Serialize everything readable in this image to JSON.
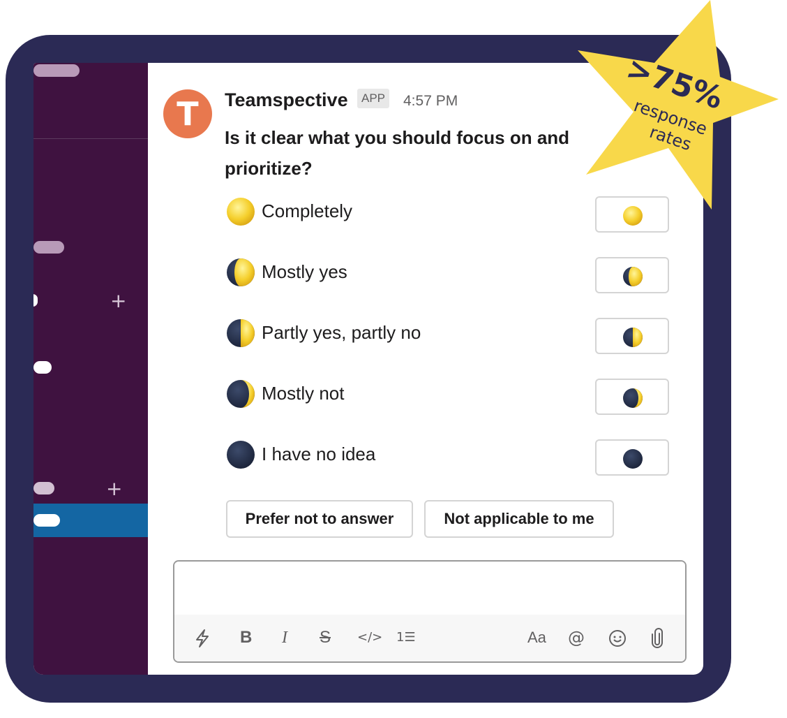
{
  "message": {
    "sender": "Teamspective",
    "avatar_letter": "T",
    "badge": "APP",
    "time": "4:57 PM",
    "question": "Is it clear what you should focus on and prioritize?"
  },
  "options": [
    {
      "label": "Completely",
      "icon": "full-moon-icon"
    },
    {
      "label": "Mostly yes",
      "icon": "waxing-gibbous-moon-icon"
    },
    {
      "label": "Partly yes, partly no",
      "icon": "first-quarter-moon-icon"
    },
    {
      "label": "Mostly not",
      "icon": "waxing-crescent-moon-icon"
    },
    {
      "label": "I have no idea",
      "icon": "new-moon-icon"
    }
  ],
  "extra_buttons": {
    "prefer_not": "Prefer not to answer",
    "not_applicable": "Not applicable to me"
  },
  "composer": {
    "bold": "B",
    "italic": "I",
    "strike": "S",
    "code": "</>",
    "list": "1☰",
    "format": "Aa",
    "mention": "@"
  },
  "badge_star": {
    "percent": ">75%",
    "line1": "response",
    "line2": "rates",
    "color": "#f8d84a"
  },
  "colors": {
    "frame": "#2b2a55",
    "sidebar": "#3f1240",
    "sidebar_active": "#1466a3",
    "avatar": "#e8784e"
  }
}
